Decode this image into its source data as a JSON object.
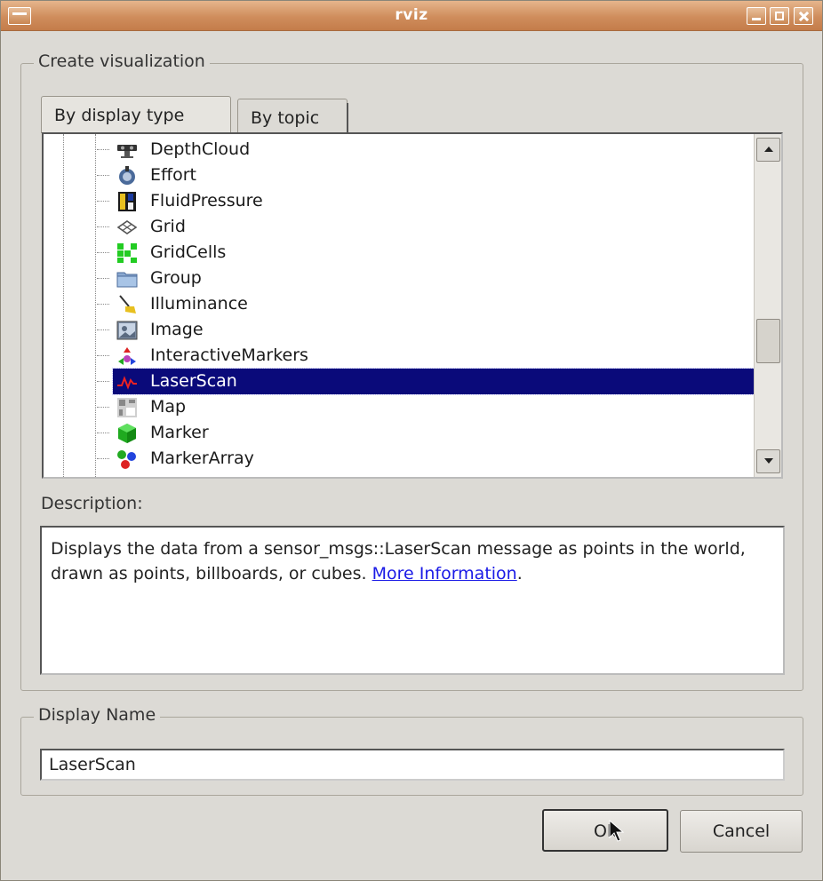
{
  "window": {
    "title": "rviz"
  },
  "create_group": {
    "title": "Create visualization",
    "tabs": [
      {
        "label": "By display type",
        "active": true
      },
      {
        "label": "By topic",
        "active": false
      }
    ]
  },
  "tree": {
    "items": [
      {
        "label": "DepthCloud",
        "icon": "depth-camera-icon",
        "selected": false
      },
      {
        "label": "Effort",
        "icon": "effort-icon",
        "selected": false
      },
      {
        "label": "FluidPressure",
        "icon": "gauge-icon",
        "selected": false
      },
      {
        "label": "Grid",
        "icon": "grid-icon",
        "selected": false
      },
      {
        "label": "GridCells",
        "icon": "grid-cells-icon",
        "selected": false
      },
      {
        "label": "Group",
        "icon": "folder-icon",
        "selected": false
      },
      {
        "label": "Illuminance",
        "icon": "lamp-icon",
        "selected": false
      },
      {
        "label": "Image",
        "icon": "image-icon",
        "selected": false
      },
      {
        "label": "InteractiveMarkers",
        "icon": "interactive-markers-icon",
        "selected": false
      },
      {
        "label": "LaserScan",
        "icon": "laser-scan-icon",
        "selected": true
      },
      {
        "label": "Map",
        "icon": "map-icon",
        "selected": false
      },
      {
        "label": "Marker",
        "icon": "cube-icon",
        "selected": false
      },
      {
        "label": "MarkerArray",
        "icon": "marker-array-icon",
        "selected": false
      }
    ]
  },
  "description": {
    "label": "Description:",
    "text": "Displays the data from a sensor_msgs::LaserScan message as points in the world, drawn as points, billboards, or cubes. ",
    "link_text": "More Information",
    "trailing": "."
  },
  "display_name": {
    "title": "Display Name",
    "value": "LaserScan"
  },
  "buttons": {
    "ok": "Ok",
    "cancel": "Cancel"
  },
  "colors": {
    "titlebar": "#cf8d5c",
    "selection": "#0a0a7a",
    "link": "#1a1ae6"
  }
}
